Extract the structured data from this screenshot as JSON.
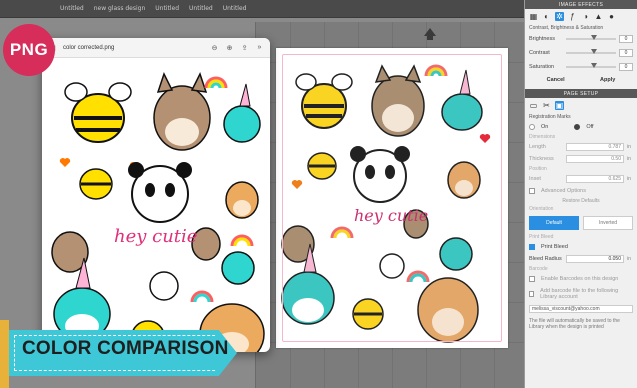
{
  "app_tabs": [
    "Untitled",
    "new glass design",
    "Untitled",
    "Untitled",
    "Untitled"
  ],
  "preview": {
    "filename": "color corrected.png",
    "sticker_text": "hey cutie"
  },
  "print_page": {
    "sticker_text": "hey cutie"
  },
  "badge": {
    "label": "PNG",
    "color": "#d62d5a"
  },
  "banner": {
    "label": "COLOR COMPARISON",
    "color": "#3ec7d6",
    "stripe_color": "#e8b13a"
  },
  "panel": {
    "image_effects": {
      "header": "IMAGE EFFECTS",
      "subheader": "Contrast, Brightness & Saturation",
      "sliders": [
        {
          "label": "Brightness",
          "value": "0"
        },
        {
          "label": "Contrast",
          "value": "0"
        },
        {
          "label": "Saturation",
          "value": "0"
        }
      ],
      "cancel": "Cancel",
      "apply": "Apply"
    },
    "page_setup": {
      "header": "PAGE SETUP",
      "registration_marks": "Registration Marks",
      "on": "On",
      "off": "Off",
      "dimensions": "Dimensions",
      "length_label": "Length",
      "length_value": "0.787",
      "thickness_label": "Thickness",
      "thickness_value": "0.50",
      "position": "Position",
      "inset_label": "Inset",
      "inset_value": "0.625",
      "advanced": "Advanced Options",
      "restore": "Restore Defaults",
      "orientation": "Orientation",
      "default": "Default",
      "inverted": "Inverted",
      "print_bleed_section": "Print Bleed",
      "print_bleed": "Print Bleed",
      "bleed_radius_label": "Bleed Radius",
      "bleed_radius_value": "0.050",
      "unit": "in",
      "barcode": "Barcode",
      "enable_barcodes": "Enable Barcodes on this design",
      "add_barcode": "Add barcode file to the following Library account",
      "email": "melissa_viscount@yahoo.com",
      "note": "The file will automatically be saved to the Library when the design is printed"
    }
  }
}
